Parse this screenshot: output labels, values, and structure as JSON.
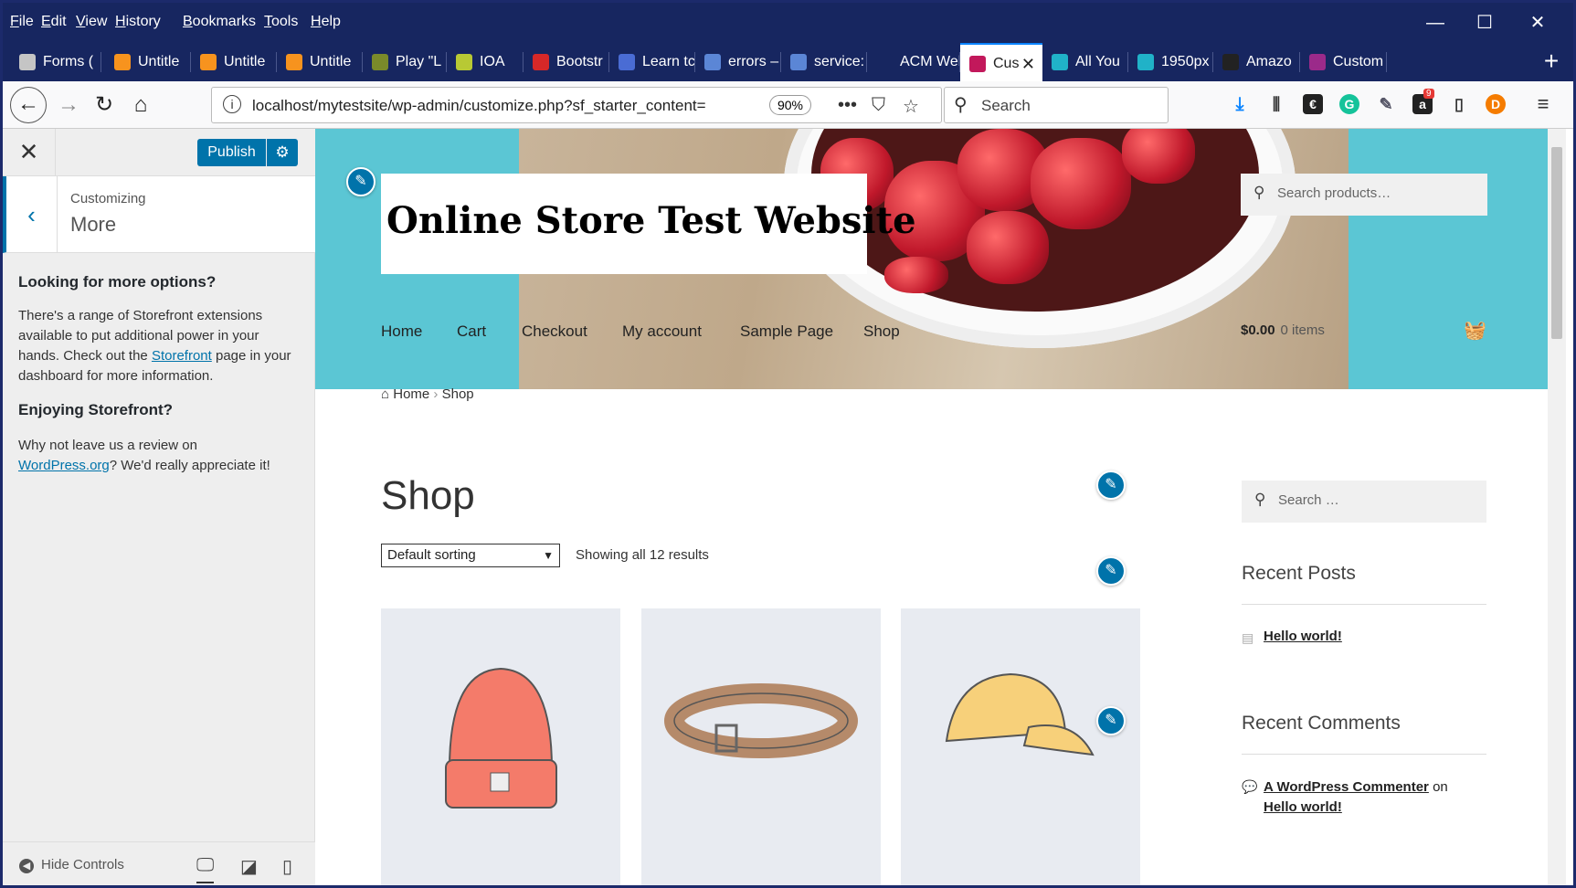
{
  "menu": [
    "File",
    "Edit",
    "View",
    "History",
    "Bookmarks",
    "Tools",
    "Help"
  ],
  "window_controls": {
    "minimize": "—",
    "maximize": "☐",
    "close": "✕"
  },
  "tabs": [
    {
      "label": "Forms (",
      "color": "#c5c5c5"
    },
    {
      "label": "Untitle",
      "color": "#f7931e"
    },
    {
      "label": "Untitle",
      "color": "#f7931e"
    },
    {
      "label": "Untitle",
      "color": "#f7931e"
    },
    {
      "label": "Play \"L",
      "color": "#7a8a2a"
    },
    {
      "label": "IOA",
      "color": "#b8c934"
    },
    {
      "label": "Bootstr",
      "color": "#d62828"
    },
    {
      "label": "Learn tc",
      "color": "#4a6cd4"
    },
    {
      "label": "errors –",
      "color": "#5b86d6"
    },
    {
      "label": "service:",
      "color": "#5b86d6"
    },
    {
      "label": "ACM Web L",
      "color": "#172660"
    },
    {
      "label": "Cus",
      "color": "#c2185b",
      "active": true
    },
    {
      "label": "All You",
      "color": "#20b2c8"
    },
    {
      "label": "1950px",
      "color": "#20b2c8"
    },
    {
      "label": "Amazo",
      "color": "#222222"
    },
    {
      "label": "Custom",
      "color": "#9b2a8a"
    }
  ],
  "tab_close": "✕",
  "newtab": "+",
  "nav": {
    "url": "localhost/mytestsite/wp-admin/customize.php?sf_starter_content=",
    "zoom": "90%",
    "search_placeholder": "Search",
    "info": "i",
    "more": "•••",
    "pocket": "⛉",
    "star": "☆"
  },
  "toolbar_icons": {
    "amazon_badge": "9"
  },
  "customizer": {
    "close": "✕",
    "publish": "Publish",
    "gear": "⚙",
    "back": "‹",
    "customizing": "Customizing",
    "section": "More",
    "h1": "Looking for more options?",
    "p1a": "There's a range of Storefront extensions available to put additional power in your hands. Check out the ",
    "p1link": "Storefront",
    "p1b": " page in your dashboard for more information.",
    "h2": "Enjoying Storefront?",
    "p2a": "Why not leave us a review on ",
    "p2link": "WordPress.org",
    "p2b": "? We'd really appreciate it!",
    "hide_controls": "Hide Controls"
  },
  "site": {
    "title": "Online Store Test Website",
    "header_search": "Search products…",
    "nav": [
      "Home",
      "Cart",
      "Checkout",
      "My account",
      "Sample Page",
      "Shop"
    ],
    "cart_total": "$0.00",
    "cart_items": "0 items",
    "breadcrumb_home": "Home",
    "breadcrumb_sep": "›",
    "breadcrumb_current": "Shop",
    "page_title": "Shop",
    "sorting": "Default sorting",
    "result_count": "Showing all 12 results",
    "sidebar_search": "Search …",
    "recent_posts": "Recent Posts",
    "post1": "Hello world!",
    "recent_comments": "Recent Comments",
    "comment_author": "A WordPress Commenter",
    "comment_on": "on",
    "comment_post": "Hello world!"
  }
}
